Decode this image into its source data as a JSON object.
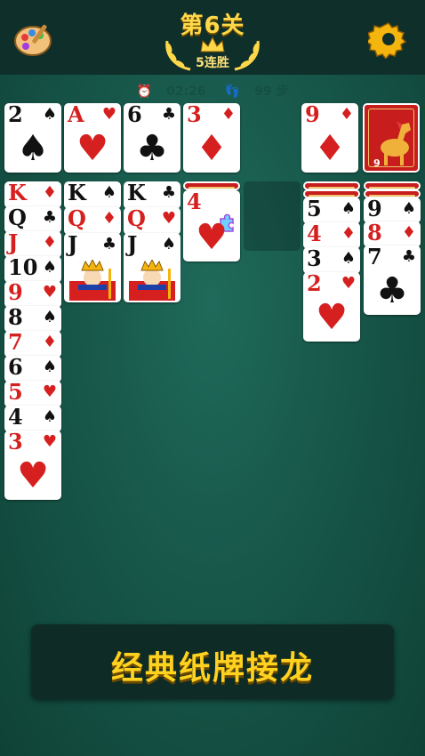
{
  "header": {
    "level_title": "第6关",
    "streak_label": "5连胜"
  },
  "stats": {
    "timer": "02:26",
    "moves": "99 步"
  },
  "banner": {
    "text": "经典纸牌接龙"
  },
  "icons": {
    "palette": "palette-icon",
    "settings": "gear-icon",
    "crown": "crown-icon",
    "clock": "clock-icon",
    "footprint": "footprint-icon"
  },
  "colors": {
    "felt": "#17574a",
    "topbar": "#0f2f2a",
    "gold": "#ffd84a",
    "red_suit": "#d62020",
    "card_back": "#c71d1d"
  },
  "foundations": [
    {
      "rank": "2",
      "suit": "♠"
    },
    {
      "rank": "A",
      "suit": "♥"
    },
    {
      "rank": "6",
      "suit": "♣"
    },
    {
      "rank": "3",
      "suit": "♦"
    }
  ],
  "waste": {
    "rank": "9",
    "suit": "♦"
  },
  "stock_card": {
    "rank": "9"
  },
  "tableau": {
    "col1": [
      {
        "rank": "K",
        "suit": "♦"
      },
      {
        "rank": "Q",
        "suit": "♣"
      },
      {
        "rank": "J",
        "suit": "♦"
      },
      {
        "rank": "10",
        "suit": "♠"
      },
      {
        "rank": "9",
        "suit": "♥"
      },
      {
        "rank": "8",
        "suit": "♠"
      },
      {
        "rank": "7",
        "suit": "♦"
      },
      {
        "rank": "6",
        "suit": "♠"
      },
      {
        "rank": "5",
        "suit": "♥"
      },
      {
        "rank": "4",
        "suit": "♠"
      },
      {
        "rank": "3",
        "suit": "♥"
      }
    ],
    "col2": [
      {
        "rank": "K",
        "suit": "♠"
      },
      {
        "rank": "Q",
        "suit": "♦"
      },
      {
        "rank": "J",
        "suit": "♣"
      }
    ],
    "col3": [
      {
        "rank": "K",
        "suit": "♣"
      },
      {
        "rank": "Q",
        "suit": "♥"
      },
      {
        "rank": "J",
        "suit": "♠"
      }
    ],
    "col4": [
      {
        "rank": "4",
        "suit": "♥"
      }
    ],
    "col6": [
      {
        "rank": "5",
        "suit": "♠"
      },
      {
        "rank": "4",
        "suit": "♦"
      },
      {
        "rank": "3",
        "suit": "♠"
      },
      {
        "rank": "2",
        "suit": "♥"
      }
    ],
    "col7": [
      {
        "rank": "9",
        "suit": "♠"
      },
      {
        "rank": "8",
        "suit": "♦"
      },
      {
        "rank": "7",
        "suit": "♣"
      }
    ]
  }
}
